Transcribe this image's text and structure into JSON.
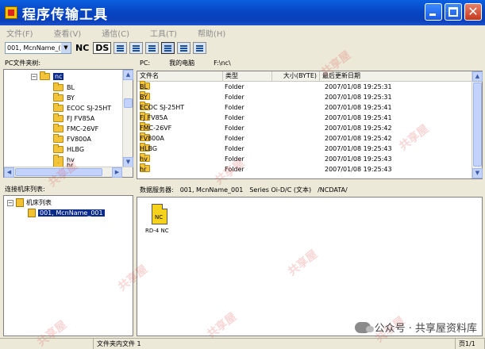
{
  "window": {
    "title": "程序传输工具"
  },
  "menu": [
    "文件(F)",
    "查看(V)",
    "通信(C)",
    "工具(T)",
    "帮助(H)"
  ],
  "toolbar": {
    "machine_value": "001, McnName_(",
    "nc_label": "NC",
    "ds_label": "DS"
  },
  "pc_tree": {
    "header": "PC文件夹树:",
    "root": "nc",
    "items": [
      "BL",
      "BY",
      "ECOC SJ-25HT",
      "FJ FV85A",
      "FMC-26VF",
      "FV800A",
      "HLBG",
      "hv",
      "hr"
    ]
  },
  "pc_path": {
    "label": "PC:",
    "location": "我的电脑",
    "path": "F:\\nc\\"
  },
  "file_list": {
    "columns": [
      "文件名",
      "类型",
      "大小(BYTE)",
      "最后更新日期"
    ],
    "rows": [
      {
        "name": "BL",
        "type": "Folder",
        "date": "2007/01/08 19:25:31"
      },
      {
        "name": "BY",
        "type": "Folder",
        "date": "2007/01/08 19:25:31"
      },
      {
        "name": "ECOC SJ-25HT",
        "type": "Folder",
        "date": "2007/01/08 19:25:41"
      },
      {
        "name": "FJ FV85A",
        "type": "Folder",
        "date": "2007/01/08 19:25:41"
      },
      {
        "name": "FMC-26VF",
        "type": "Folder",
        "date": "2007/01/08 19:25:42"
      },
      {
        "name": "FV800A",
        "type": "Folder",
        "date": "2007/01/08 19:25:42"
      },
      {
        "name": "HLBG",
        "type": "Folder",
        "date": "2007/01/08 19:25:43"
      },
      {
        "name": "hv",
        "type": "Folder",
        "date": "2007/01/08 19:25:43"
      },
      {
        "name": "hr",
        "type": "Folder",
        "date": "2007/01/08 19:25:43"
      }
    ]
  },
  "machine_tree": {
    "header": "连接机床列表:",
    "root": "机床列表",
    "selected": "001, McnName_001"
  },
  "server_path": {
    "label": "数据服务器:",
    "machine": "001, McnName_001",
    "series": "Series Oi-D/C (文本)",
    "path": "/NCDATA/"
  },
  "server_files": [
    {
      "icon_text": "NC",
      "name": "RD-4 NC"
    }
  ],
  "status": {
    "left": "",
    "middle": "文件夹内文件 1",
    "page": "页1/1"
  },
  "watermark": {
    "text": "共享屋",
    "brand": "公众号 · 共享屋资料库"
  }
}
